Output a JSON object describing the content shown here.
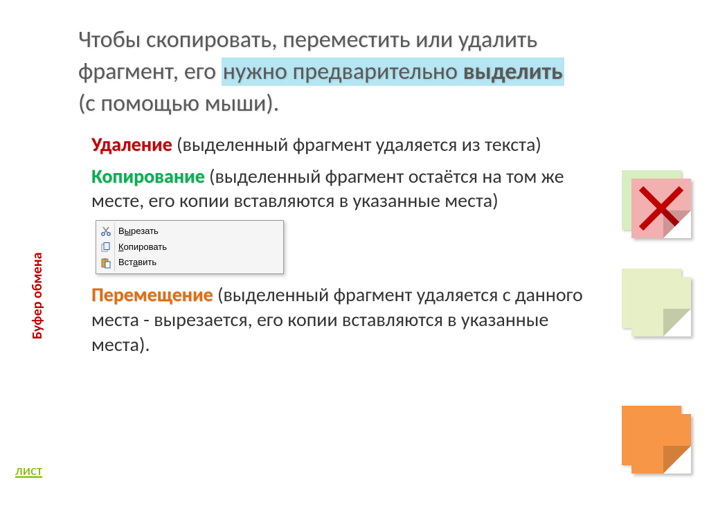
{
  "title": {
    "line1a": "Чтобы скопировать, переместить или удалить",
    "line2a": "фрагмент, его ",
    "highlighted_1": "нужно предварительно ",
    "highlighted_bold": "выделить",
    "line3a": "(с помощью мыши)."
  },
  "paragraphs": {
    "delete": {
      "term": "Удаление",
      "rest": " (выделенный фрагмент удаляется из текста)"
    },
    "copy": {
      "term": "Копирование",
      "rest": " (выделенный фрагмент остаётся на том же месте,  его копии вставляются в указанные места)"
    },
    "move": {
      "term": "Перемещение",
      "rest": " (выделенный фрагмент удаляется с данного места -  вырезается, его копии вставляются в указанные места)."
    }
  },
  "context_menu": {
    "cut_pre": "В",
    "cut_u": "ы",
    "cut_post": "резать",
    "copy_pre": "",
    "copy_u": "К",
    "copy_post": "опировать",
    "paste_pre": "Вст",
    "paste_u": "а",
    "paste_post": "вить"
  },
  "sidebar": {
    "clipboard": "Буфер обмена",
    "link": "лист"
  },
  "icons": {
    "scissors": "scissors-icon",
    "copy": "copy-icon",
    "paste": "paste-icon",
    "red_x": "red-x-icon"
  }
}
